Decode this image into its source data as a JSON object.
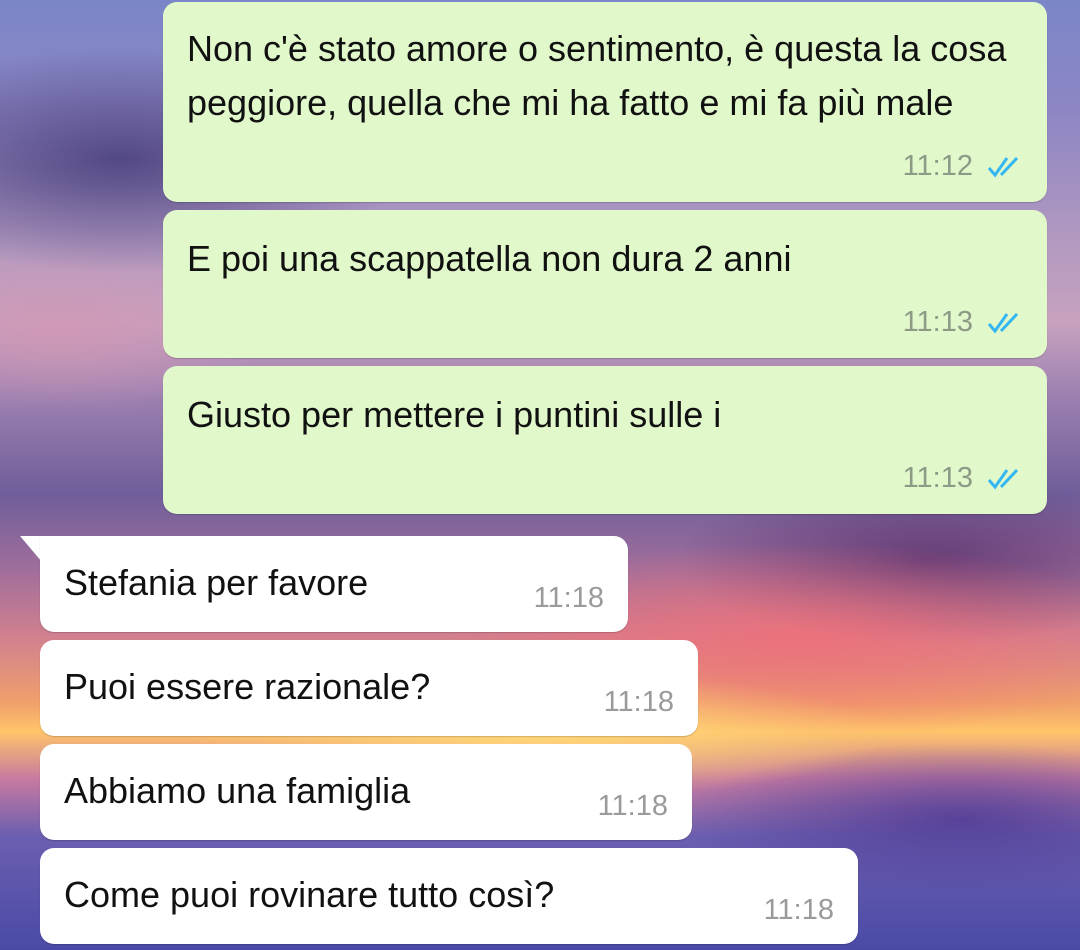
{
  "colors": {
    "outgoing_bubble": "#e1f8cb",
    "incoming_bubble": "#ffffff",
    "read_tick": "#34b7f1"
  },
  "messages": [
    {
      "direction": "outgoing",
      "text": "Non c'è stato amore o sentimento, è questa la cosa peggiore, quella che mi ha fatto e mi fa più male",
      "time": "11:12",
      "status_icon": "double-check-read-icon"
    },
    {
      "direction": "outgoing",
      "text": "E poi una scappatella non dura 2 anni",
      "time": "11:13",
      "status_icon": "double-check-read-icon"
    },
    {
      "direction": "outgoing",
      "text": "Giusto per mettere i puntini sulle i",
      "time": "11:13",
      "status_icon": "double-check-read-icon"
    },
    {
      "direction": "incoming",
      "text": "Stefania per favore",
      "time": "11:18"
    },
    {
      "direction": "incoming",
      "text": "Puoi essere razionale?",
      "time": "11:18"
    },
    {
      "direction": "incoming",
      "text": "Abbiamo una famiglia",
      "time": "11:18"
    },
    {
      "direction": "incoming",
      "text": "Come puoi rovinare tutto così?",
      "time": "11:18"
    }
  ]
}
